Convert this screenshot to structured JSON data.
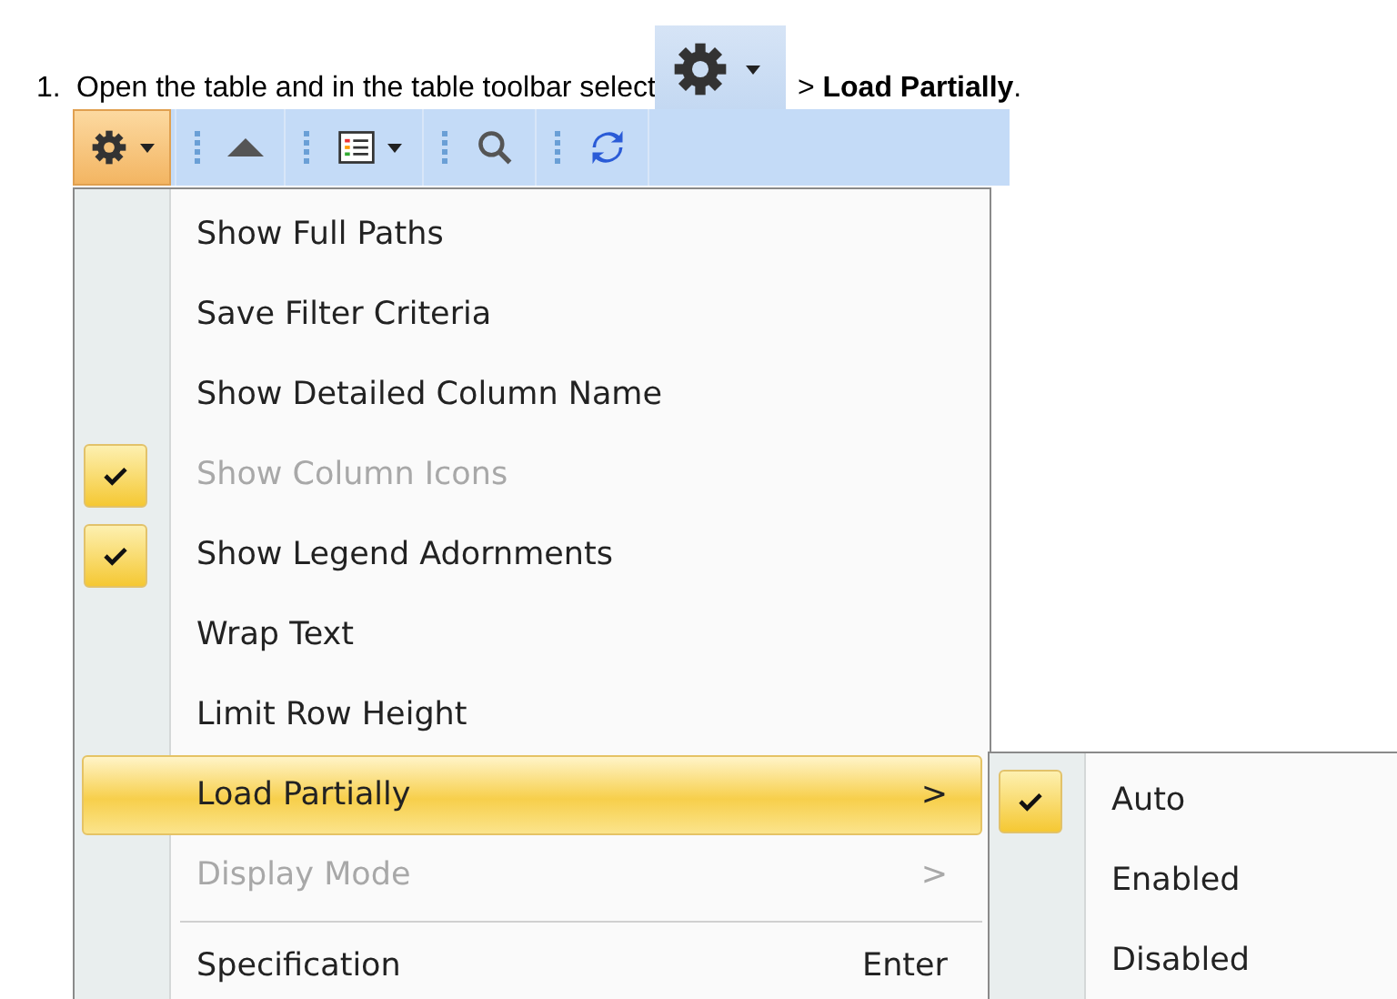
{
  "instruction": {
    "number": "1.",
    "text_before": "Open the table and in the table toolbar select",
    "text_after": "> **Load Partially**."
  },
  "toolbar": {
    "buttons": [
      {
        "kind": "gear",
        "caret": true,
        "selected": true
      },
      {
        "kind": "up",
        "caret": false,
        "selected": false
      },
      {
        "kind": "list",
        "caret": true,
        "selected": false
      },
      {
        "kind": "search",
        "caret": false,
        "selected": false
      },
      {
        "kind": "refresh",
        "caret": false,
        "selected": false
      }
    ]
  },
  "menu": {
    "items": [
      {
        "kind": "item",
        "label": "Show Full Paths",
        "checked": false,
        "disabled": false,
        "selected": false
      },
      {
        "kind": "item",
        "label": "Save Filter Criteria",
        "checked": false,
        "disabled": false,
        "selected": false
      },
      {
        "kind": "item",
        "label": "Show Detailed Column Name",
        "checked": false,
        "disabled": false,
        "selected": false
      },
      {
        "kind": "item",
        "label": "Show Column Icons",
        "checked": true,
        "disabled": true,
        "selected": false
      },
      {
        "kind": "item",
        "label": "Show Legend Adornments",
        "checked": true,
        "disabled": false,
        "selected": false
      },
      {
        "kind": "item",
        "label": "Wrap Text",
        "checked": false,
        "disabled": false,
        "selected": false
      },
      {
        "kind": "item",
        "label": "Limit Row Height",
        "checked": false,
        "disabled": false,
        "selected": false
      },
      {
        "kind": "item",
        "label": "Load Partially",
        "checked": false,
        "disabled": false,
        "selected": true,
        "arrow": ">"
      },
      {
        "kind": "item",
        "label": "Display Mode",
        "checked": false,
        "disabled": true,
        "selected": false,
        "arrow": ">"
      },
      {
        "kind": "separator"
      },
      {
        "kind": "item",
        "label": "Specification",
        "checked": false,
        "disabled": false,
        "selected": false,
        "shortcut": "Enter"
      }
    ]
  },
  "submenu": {
    "items": [
      {
        "label": "Auto",
        "checked": true
      },
      {
        "label": "Enabled",
        "checked": false
      },
      {
        "label": "Disabled",
        "checked": false
      }
    ]
  }
}
